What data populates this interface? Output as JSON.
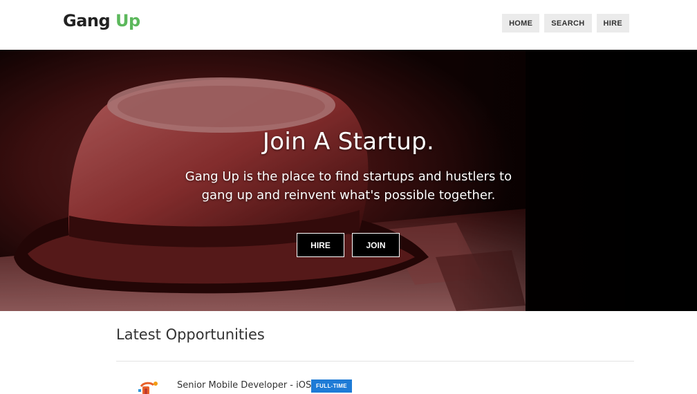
{
  "header": {
    "logo_part1": "Gang",
    "logo_part2": "Up",
    "nav": [
      "HOME",
      "SEARCH",
      "HIRE"
    ]
  },
  "hero": {
    "title": "Join A Startup.",
    "subtitle": "Gang Up is the place to find startups and hustlers to gang up and reinvent what's possible together.",
    "buttons": [
      "HIRE",
      "JOIN"
    ]
  },
  "opportunities": {
    "heading": "Latest Opportunities",
    "jobs": [
      {
        "title": "Senior Mobile Developer - iOS",
        "badge": "FULL-TIME"
      }
    ]
  },
  "colors": {
    "logo_accent": "#5cb85c",
    "badge": "#1e7bd6",
    "hero_tint": "#a83a3a"
  }
}
